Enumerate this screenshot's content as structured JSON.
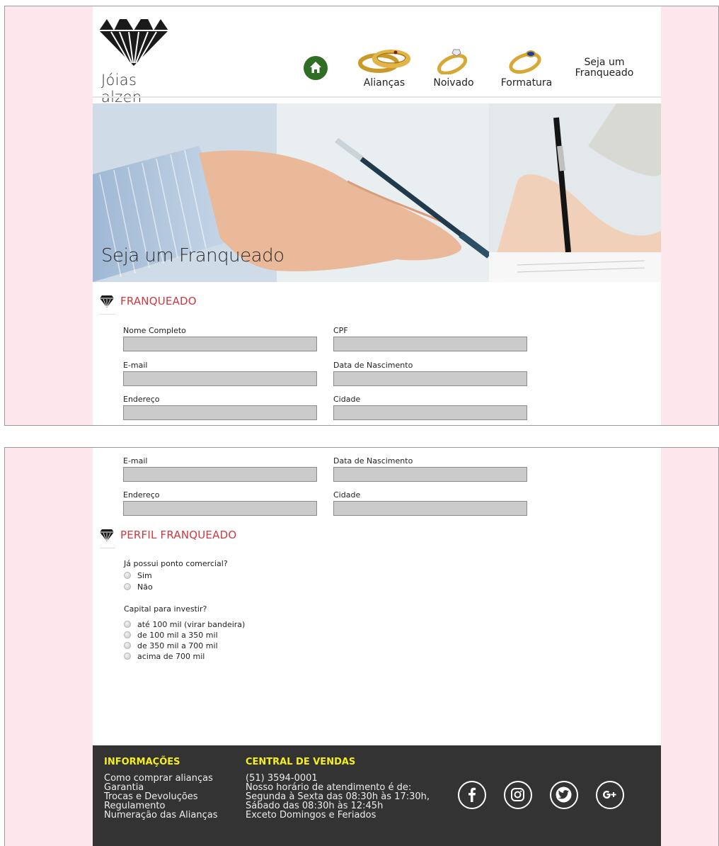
{
  "brand": {
    "name": "Jóias alzen"
  },
  "nav": {
    "home_icon": "home-icon",
    "aliancas": "Alianças",
    "noivado": "Noivado",
    "formatura": "Formatura",
    "franqueado_line1": "Seja um",
    "franqueado_line2": "Franqueado"
  },
  "hero": {
    "caption": "Seja um Franqueado"
  },
  "sections": {
    "franqueado": "FRANQUEADO",
    "perfil": "PERFIL FRANQUEADO"
  },
  "form": {
    "nome": "Nome Completo",
    "cpf": "CPF",
    "email": "E-mail",
    "nascimento": "Data de Nascimento",
    "endereco": "Endereço",
    "cidade": "Cidade"
  },
  "perfil": {
    "q1": "Já possui ponto comercial?",
    "q1_options": [
      "Sim",
      "Não"
    ],
    "q2": "Capital para investir?",
    "q2_options": [
      "até 100 mil (virar bandeira)",
      "de 100 mil a 350 mil",
      "de 350 mil a 700 mil",
      "acima de 700 mil"
    ]
  },
  "footer": {
    "info_title": "INFORMAÇÕES",
    "info_links": [
      "Como comprar alianças",
      "Garantia",
      "Trocas e Devoluções",
      "Regulamento",
      "Numeração das Alianças"
    ],
    "vendas_title": "CENTRAL DE VENDAS",
    "vendas_lines": [
      "(51) 3594-0001",
      "Nosso horário de atendimento é de:",
      "Segunda à Sexta das 08:30h às 17:30h,",
      "Sábado das 08:30h às 12:45h",
      "Exceto Domingos e Feriados"
    ],
    "social_icons": [
      "facebook-icon",
      "instagram-icon",
      "twitter-icon",
      "google-plus-icon"
    ]
  },
  "colors": {
    "page_bg": "#fde6ec",
    "section_title": "#cc3a3f",
    "footer_bg": "#333333",
    "footer_heading": "#f5ee1b",
    "home_button": "#2f6e24",
    "input_bg": "#cbcbcb"
  }
}
